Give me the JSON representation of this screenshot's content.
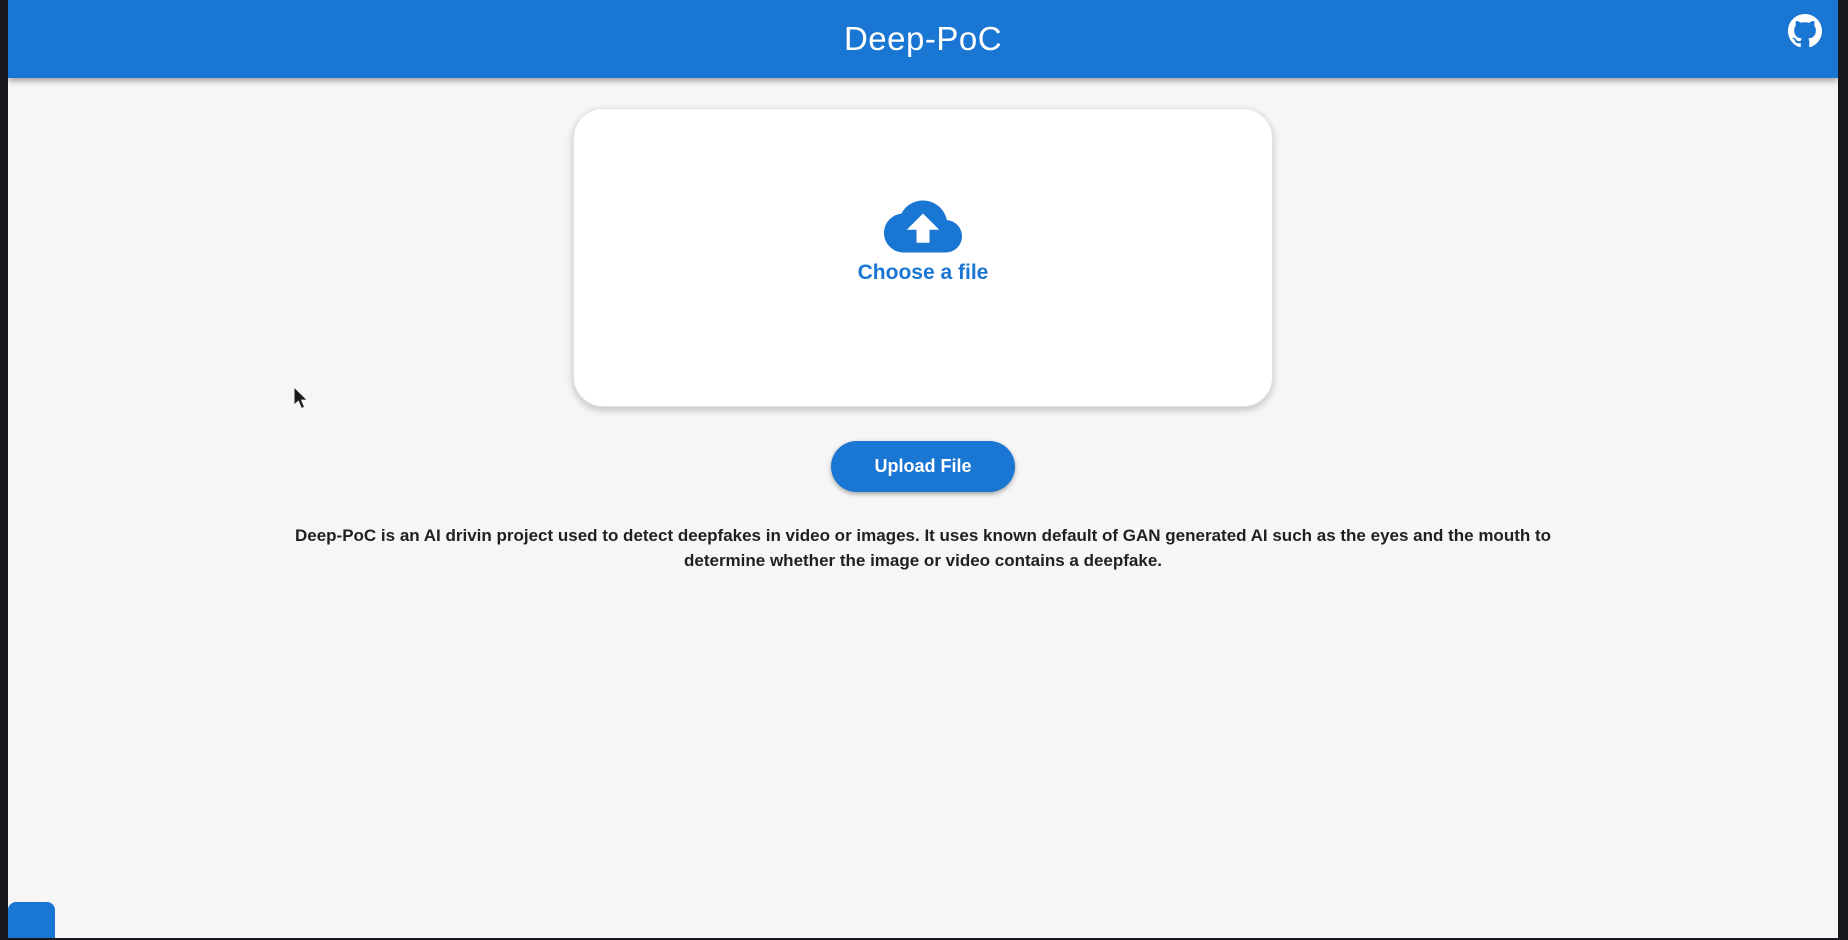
{
  "header": {
    "title": "Deep-PoC",
    "background_color": "#1976d2",
    "github_icon": "github-octocat-mark"
  },
  "uploader": {
    "dropzone_icon": "cloud-upload-icon",
    "choose_label": "Choose a file",
    "upload_button_label": "Upload File"
  },
  "description": {
    "text": "Deep-PoC is an AI drivin project used to detect deepfakes in video or images. It uses known default of GAN generated AI such as the eyes and the mouth to determine whether the image or video contains a deepfake."
  },
  "colors": {
    "accent_blue": "#1976d2",
    "page_background": "#f6f6f7",
    "card_background": "#ffffff",
    "body_text": "#1f2023",
    "edge_border": "#17181c"
  }
}
